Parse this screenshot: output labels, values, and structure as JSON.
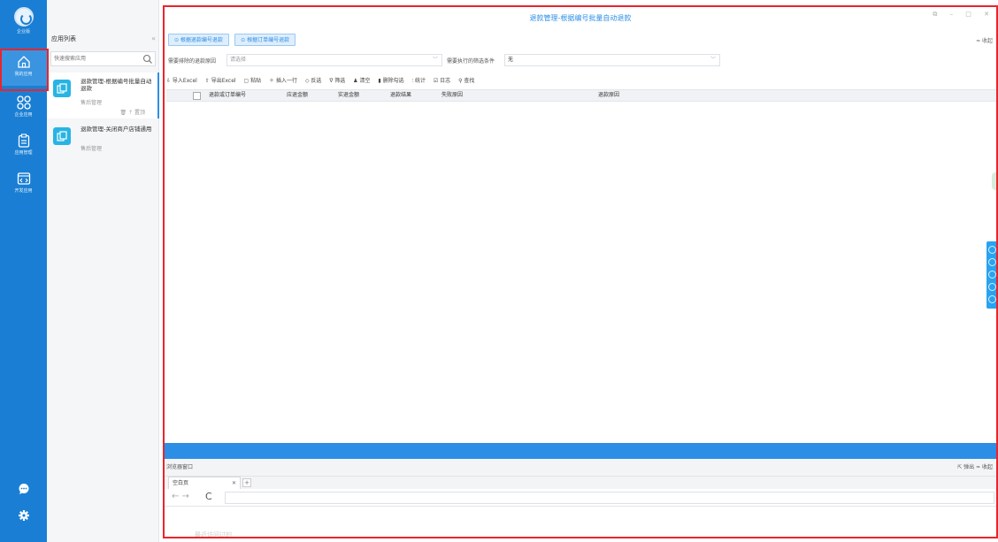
{
  "rail": {
    "brand_label": "企业版",
    "items": [
      {
        "label": "我的应用"
      },
      {
        "label": "企业应用"
      },
      {
        "label": "应用管理"
      },
      {
        "label": "开发应用"
      }
    ]
  },
  "applist": {
    "title": "应用列表",
    "collapse": "«",
    "search_placeholder": "快速搜索应用",
    "cards": [
      {
        "title": "退款管理-根据编号批量自动退款",
        "subtitle": "售后管理",
        "actions": "🗑 ⇡ 置顶"
      },
      {
        "title": "退款管理-关闭商户店铺通用",
        "subtitle": "售后管理"
      }
    ]
  },
  "main": {
    "title": "退款管理-根据编号批量自动退款",
    "window_controls": "⧉ – □ ✕",
    "buttons": [
      "⊙ 根据退款编号退款",
      "⊙ 根据订单编号退款"
    ],
    "collapse_label": "≈ 收起",
    "filter": {
      "label1": "需要排除的退款原因",
      "placeholder1": "请选择",
      "label2": "需要执行的筛选条件",
      "value2": "无"
    },
    "toolbar": [
      "⇩ 导入Excel",
      "⇧ 导出Excel",
      "▢ 粘贴",
      "＋ 插入一行",
      "◇ 反选",
      "∇ 筛选",
      "♟ 清空",
      "▮ 删除勾选",
      "⫶ 统计",
      "☑ 日志",
      "⚲ 查找"
    ],
    "columns": [
      "退款或订单编号",
      "应退金额",
      "实退金额",
      "退款结果",
      "失败原因",
      "退款原因"
    ]
  },
  "browser": {
    "title": "浏览器窗口",
    "right_actions": "⇱ 弹出  ≈ 收起",
    "tab_label": "空白页",
    "tab_close": "✕",
    "add_tab": "+",
    "nav": "← →",
    "reload": "C",
    "recent": "最近访问过的"
  },
  "colors": {
    "rail": "#1a7fd4",
    "accent": "#2d8ee6",
    "highlight": "#e8252d"
  }
}
